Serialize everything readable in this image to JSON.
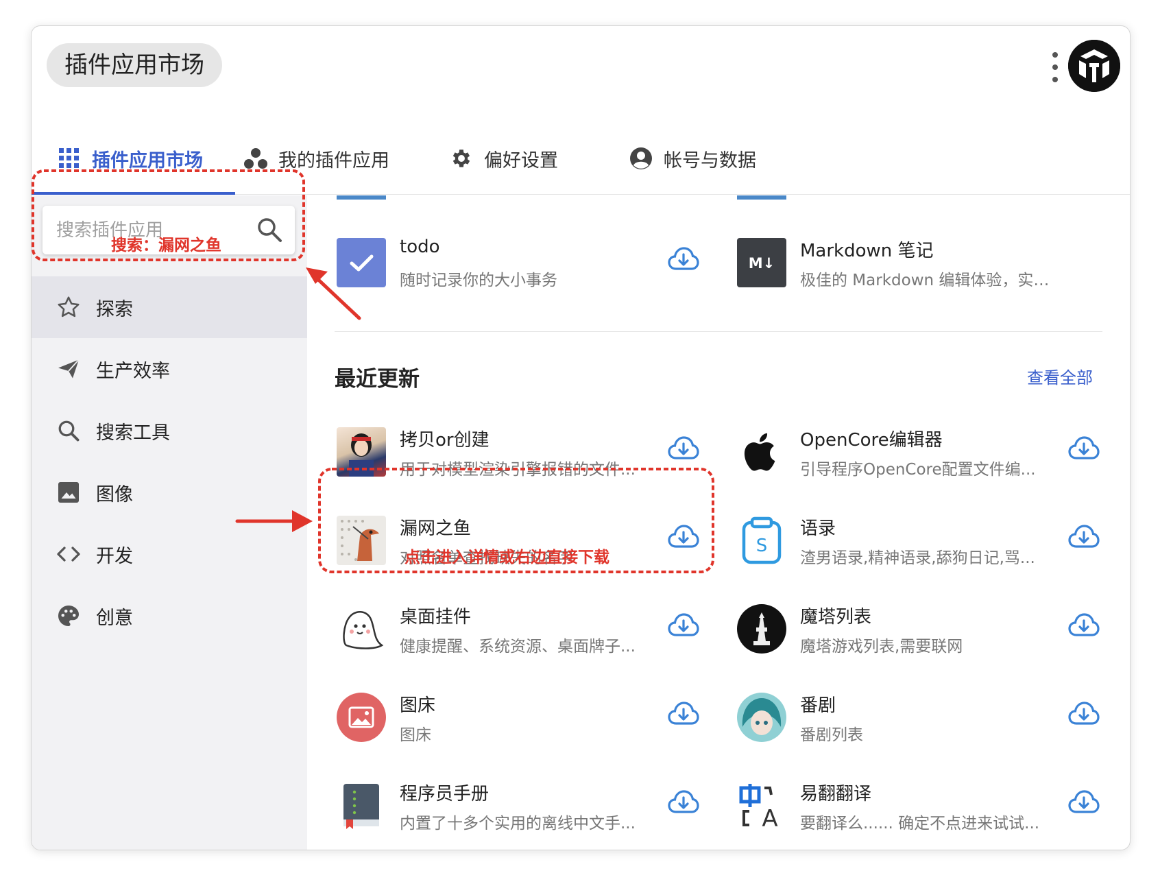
{
  "header": {
    "title": "插件应用市场"
  },
  "tabs": [
    {
      "label": "插件应用市场",
      "icon": "apps-grid-icon"
    },
    {
      "label": "我的插件应用",
      "icon": "bubbles-icon"
    },
    {
      "label": "偏好设置",
      "icon": "gear-icon"
    },
    {
      "label": "帐号与数据",
      "icon": "account-circle-icon"
    }
  ],
  "search": {
    "placeholder": "搜索插件应用"
  },
  "sidebar": {
    "items": [
      {
        "label": "探索",
        "icon": "star-icon"
      },
      {
        "label": "生产效率",
        "icon": "paper-plane-icon"
      },
      {
        "label": "搜索工具",
        "icon": "magnifier-icon"
      },
      {
        "label": "图像",
        "icon": "image-icon"
      },
      {
        "label": "开发",
        "icon": "code-icon"
      },
      {
        "label": "创意",
        "icon": "palette-icon"
      }
    ]
  },
  "featured": [
    {
      "name": "todo",
      "desc": "随时记录你的大小事务"
    },
    {
      "name": "Markdown 笔记",
      "desc": "极佳的 Markdown 编辑体验，实时预..."
    }
  ],
  "recent": {
    "title": "最近更新",
    "view_all": "查看全部",
    "apps": [
      {
        "name": "拷贝or创建",
        "desc": "用于对模型渲染引擎报错的文件..."
      },
      {
        "name": "OpenCore编辑器",
        "desc": "引导程序OpenCore配置文件编..."
      },
      {
        "name": "漏网之鱼",
        "desc": "对照名单查找缺失的名字"
      },
      {
        "name": "语录",
        "desc": "渣男语录,精神语录,舔狗日记,骂..."
      },
      {
        "name": "桌面挂件",
        "desc": "健康提醒、系统资源、桌面牌子..."
      },
      {
        "name": "魔塔列表",
        "desc": "魔塔游戏列表,需要联网"
      },
      {
        "name": "图床",
        "desc": "图床"
      },
      {
        "name": "番剧",
        "desc": "番剧列表"
      },
      {
        "name": "程序员手册",
        "desc": "内置了十多个实用的离线中文手..."
      },
      {
        "name": "易翻翻译",
        "desc": "要翻译么...... 确定不点进来试试..."
      }
    ]
  },
  "annotations": {
    "search_note": "搜索：漏网之鱼",
    "click_note": "点击进入详情或右边直接下载"
  },
  "colors": {
    "accent": "#3a5fcc",
    "annotation": "#e0352b",
    "download": "#3a82d6"
  }
}
